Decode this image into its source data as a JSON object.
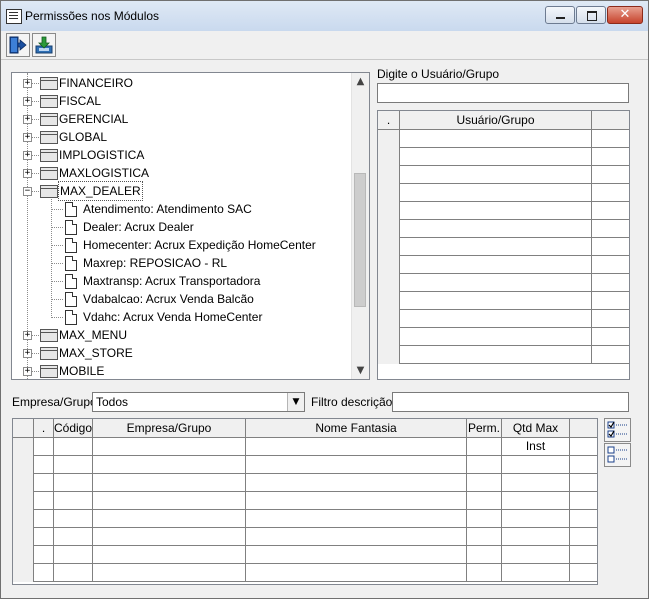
{
  "window": {
    "title": "Permissões nos Módulos",
    "close_glyph": "✕"
  },
  "toolbar": {
    "exit_icon": "exit-door-icon",
    "save_icon": "save-download-icon"
  },
  "tree": {
    "nodes": [
      {
        "label": "FINANCEIRO",
        "type": "module",
        "expander": "+"
      },
      {
        "label": "FISCAL",
        "type": "module",
        "expander": "+"
      },
      {
        "label": "GERENCIAL",
        "type": "module",
        "expander": "+"
      },
      {
        "label": "GLOBAL",
        "type": "module",
        "expander": "+"
      },
      {
        "label": "IMPLOGISTICA",
        "type": "module",
        "expander": "+"
      },
      {
        "label": "MAXLOGISTICA",
        "type": "module",
        "expander": "+"
      },
      {
        "label": "MAX_DEALER",
        "type": "module",
        "expander": "−",
        "selected": true
      },
      {
        "label": "Atendimento: Atendimento SAC",
        "type": "child"
      },
      {
        "label": "Dealer: Acrux Dealer",
        "type": "child"
      },
      {
        "label": "Homecenter: Acrux Expedição HomeCenter",
        "type": "child"
      },
      {
        "label": "Maxrep: REPOSICAO  - RL",
        "type": "child"
      },
      {
        "label": "Maxtransp: Acrux Transportadora",
        "type": "child"
      },
      {
        "label": "Vdabalcao: Acrux Venda Balcão",
        "type": "child"
      },
      {
        "label": "Vdahc: Acrux Venda HomeCenter",
        "type": "child"
      },
      {
        "label": "MAX_MENU",
        "type": "module",
        "expander": "+"
      },
      {
        "label": "MAX_STORE",
        "type": "module",
        "expander": "+"
      },
      {
        "label": "MOBILE",
        "type": "module",
        "expander": "+"
      }
    ],
    "scroll_up": "▲",
    "scroll_down": "▼"
  },
  "user_search": {
    "label": "Digite o Usuário/Grupo",
    "value": ""
  },
  "user_grid": {
    "columns": [
      ".",
      "Usuário/Grupo",
      ""
    ],
    "row_count": 13
  },
  "filters": {
    "empresa_label": "Empresa/Grupo:",
    "empresa_value": "Todos",
    "combo_arrow": "▼",
    "filtro_label": "Filtro descrição:",
    "filtro_value": ""
  },
  "main_grid": {
    "columns": [
      "",
      ".",
      "Código",
      "Empresa/Grupo",
      "Nome Fantasia",
      "Perm.",
      "Qtd Max Inst",
      ""
    ],
    "row_count": 8
  },
  "side_buttons": {
    "check_all_icon": "check-all-icon",
    "uncheck_all_icon": "uncheck-all-icon"
  }
}
